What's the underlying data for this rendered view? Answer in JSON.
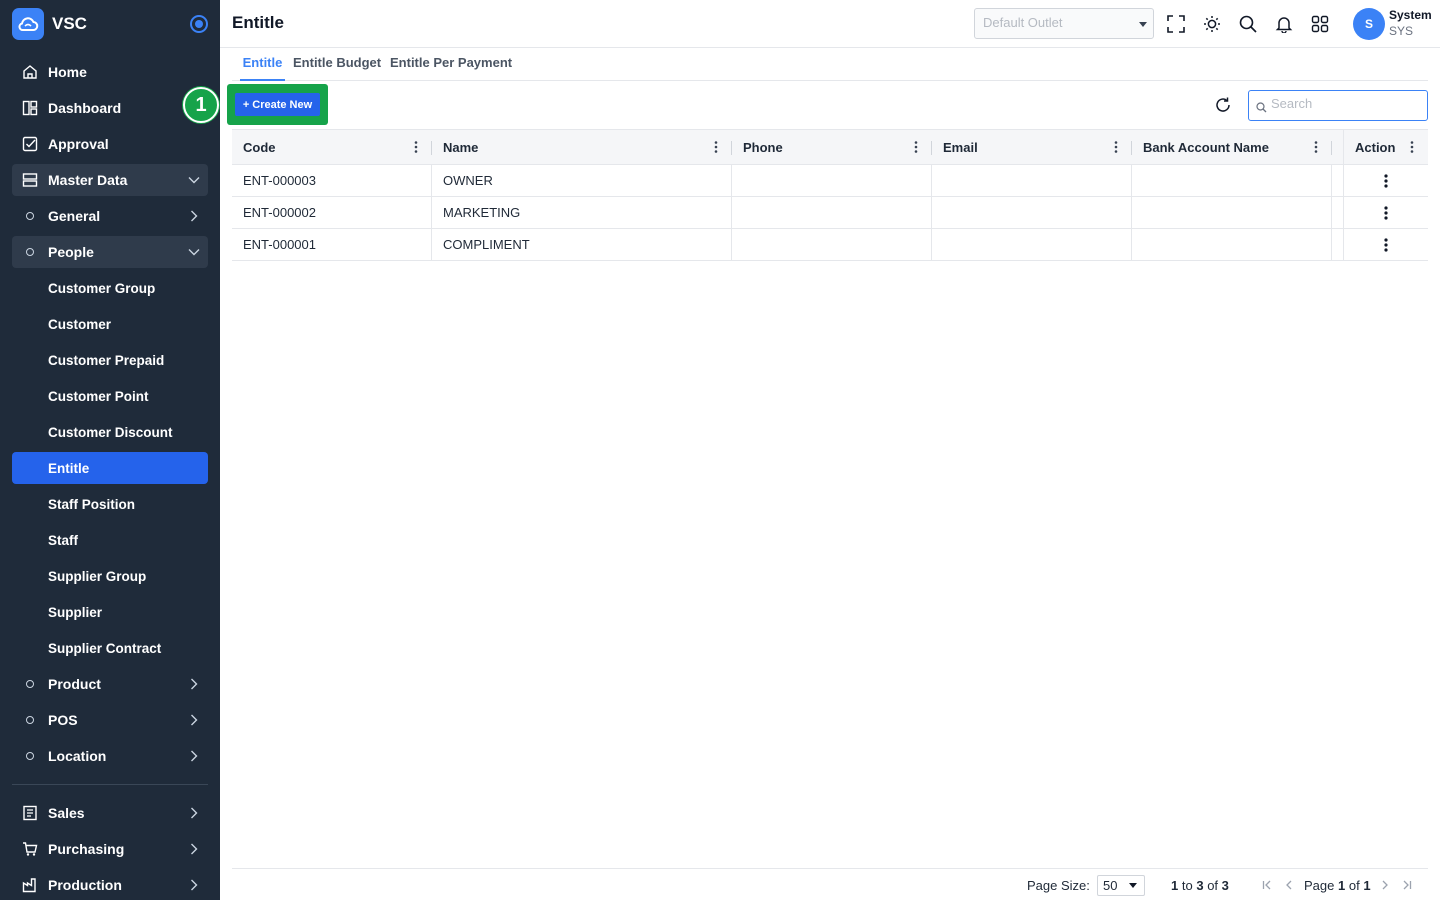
{
  "app": {
    "name": "VSC"
  },
  "sidebar": {
    "home": "Home",
    "dashboard": "Dashboard",
    "approval": "Approval",
    "master_data": "Master Data",
    "general": "General",
    "people": "People",
    "people_items": [
      "Customer Group",
      "Customer",
      "Customer Prepaid",
      "Customer Point",
      "Customer Discount",
      "Entitle",
      "Staff Position",
      "Staff",
      "Supplier Group",
      "Supplier",
      "Supplier Contract"
    ],
    "product": "Product",
    "pos": "POS",
    "location": "Location",
    "sales": "Sales",
    "purchasing": "Purchasing",
    "production": "Production"
  },
  "header": {
    "title": "Entitle",
    "outlet_placeholder": "Default Outlet",
    "user_initial": "S",
    "user_name": "System",
    "user_code": "SYS"
  },
  "tabs": [
    "Entitle",
    "Entitle Budget",
    "Entitle Per Payment"
  ],
  "toolbar": {
    "create_label": "Create New",
    "step_number": "1",
    "search_placeholder": "Search"
  },
  "table": {
    "columns": [
      "Code",
      "Name",
      "Phone",
      "Email",
      "Bank Account Name",
      "Action"
    ],
    "rows": [
      {
        "code": "ENT-000003",
        "name": "OWNER",
        "phone": "",
        "email": "",
        "bank": ""
      },
      {
        "code": "ENT-000002",
        "name": "MARKETING",
        "phone": "",
        "email": "",
        "bank": ""
      },
      {
        "code": "ENT-000001",
        "name": "COMPLIMENT",
        "phone": "",
        "email": "",
        "bank": ""
      }
    ]
  },
  "footer": {
    "page_size_label": "Page Size:",
    "page_size": "50",
    "range_from": "1",
    "range_to": "3",
    "range_total": "3",
    "range_text_to": "to",
    "range_text_of": "of",
    "page_word": "Page",
    "page_current": "1",
    "page_of": "of",
    "page_total": "1"
  },
  "colors": {
    "sidebar_bg": "#1f2b3a",
    "accent": "#2563eb",
    "highlight": "#16a34a"
  }
}
